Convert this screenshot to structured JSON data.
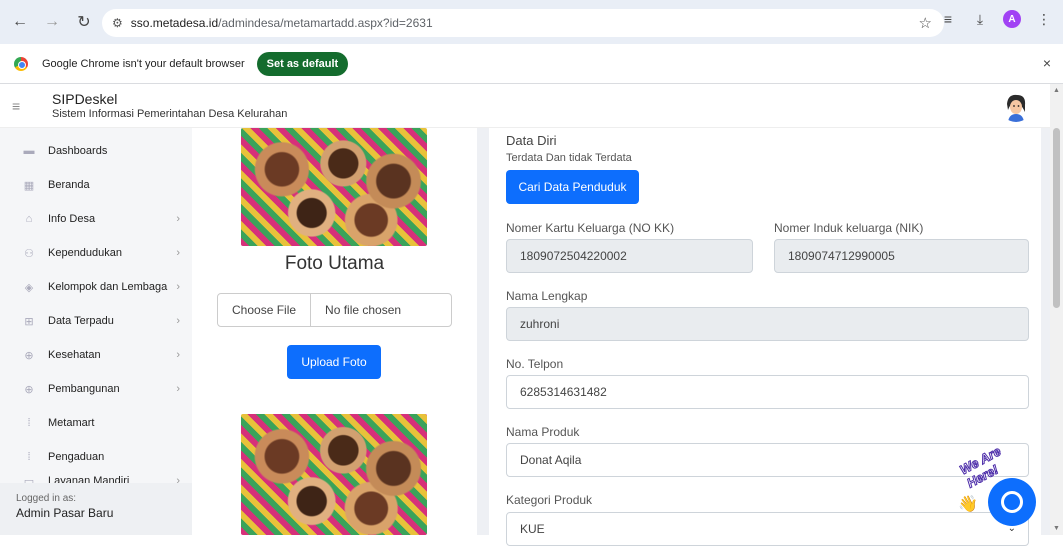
{
  "browser": {
    "back": "←",
    "forward": "→",
    "reload": "↻",
    "site_icon": "⚙",
    "url_host": "sso.metadesa.id",
    "url_path": "/admindesa/metamartadd.aspx?id=2631",
    "star": "☆",
    "tab_search": "≡",
    "download": "⤓",
    "profile_initial": "A",
    "menu": "⋮"
  },
  "infobar": {
    "message": "Google Chrome isn't your default browser",
    "button": "Set as default",
    "close": "×"
  },
  "header": {
    "menu_icon": "≡",
    "app_name": "SIPDeskel",
    "app_subtitle": "Sistem Informasi Pemerintahan Desa Kelurahan"
  },
  "sidebar": {
    "items": [
      {
        "label": "Dashboards",
        "icon": "▬",
        "chevron": ""
      },
      {
        "label": "Beranda",
        "icon": "▦",
        "chevron": ""
      },
      {
        "label": "Info Desa",
        "icon": "⌂",
        "chevron": "›"
      },
      {
        "label": "Kependudukan",
        "icon": "⚇",
        "chevron": "›"
      },
      {
        "label": "Kelompok dan Lembaga",
        "icon": "◈",
        "chevron": "›"
      },
      {
        "label": "Data Terpadu",
        "icon": "⊞",
        "chevron": "›"
      },
      {
        "label": "Kesehatan",
        "icon": "⊕",
        "chevron": "›"
      },
      {
        "label": "Pembangunan",
        "icon": "⊕",
        "chevron": "›"
      },
      {
        "label": "Metamart",
        "icon": "⁞",
        "chevron": ""
      },
      {
        "label": "Pengaduan",
        "icon": "⁞",
        "chevron": ""
      },
      {
        "label": "Layanan Mandiri",
        "icon": "▭",
        "chevron": "›"
      }
    ],
    "logged_label": "Logged in as:",
    "logged_user": "Admin Pasar Baru"
  },
  "photo": {
    "title": "Foto Utama",
    "choose_file": "Choose File",
    "no_file": "No file chosen",
    "upload": "Upload Foto"
  },
  "form": {
    "section_title": "Data Diri",
    "section_sub": "Terdata Dan tidak Terdata",
    "search_button": "Cari Data Penduduk",
    "no_kk_label": "Nomer Kartu Keluarga (NO KK)",
    "no_kk_value": "1809072504220002",
    "nik_label": "Nomer Induk keluarga (NIK)",
    "nik_value": "1809074712990005",
    "nama_label": "Nama Lengkap",
    "nama_value": "zuhroni",
    "telp_label": "No. Telpon",
    "telp_value": "6285314631482",
    "produk_label": "Nama Produk",
    "produk_value": "Donat Aqila",
    "kategori_label": "Kategori Produk",
    "kategori_value": "KUE",
    "select_arrow": "⌄"
  },
  "chat": {
    "banner": "We Are Here!",
    "wave": "👋"
  },
  "colors": {
    "primary": "#0d6efd",
    "set_default_green": "#146c2e",
    "readonly_bg": "#e9ecef"
  }
}
